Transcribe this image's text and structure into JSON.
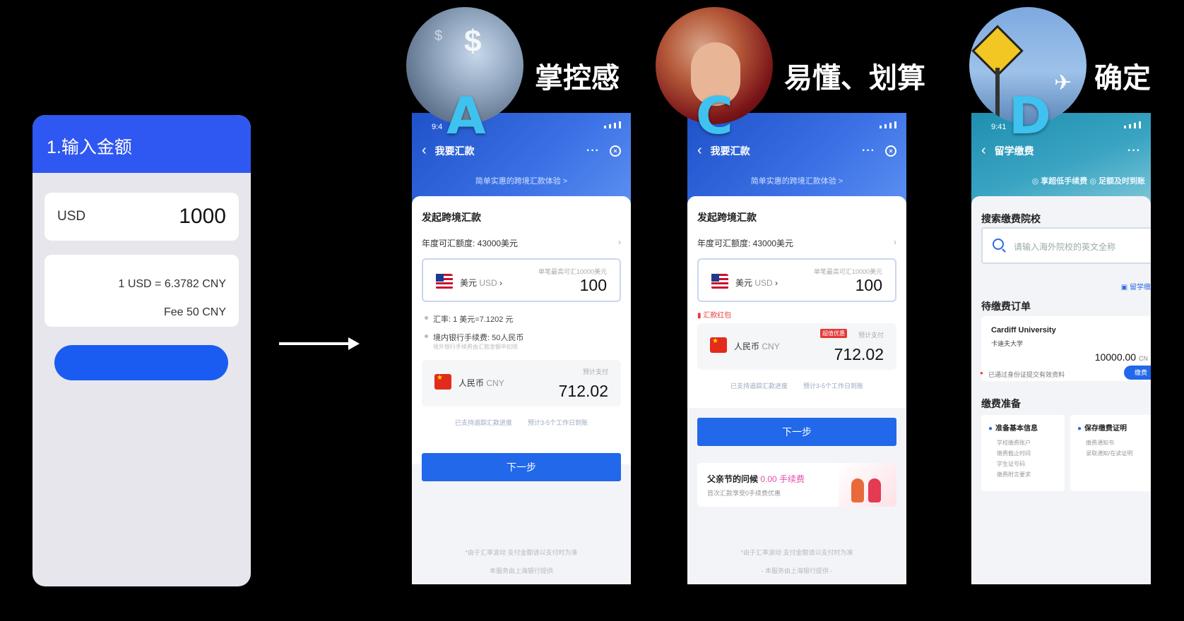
{
  "wireframe": {
    "header": "1.输入金额",
    "currency": "USD",
    "amount": "1000",
    "rate": "1 USD = 6.3782 CNY",
    "fee": "Fee  50 CNY"
  },
  "variants": {
    "a": {
      "letter": "A",
      "label": "掌控感",
      "status_time": "9:4",
      "nav_title": "我要汇款",
      "more": "···",
      "close": "×",
      "tagline": "简单实惠的跨境汇款体验 >",
      "section_title": "发起跨境汇款",
      "quota": "年度可汇额度:  43000美元",
      "send_currency": "美元",
      "send_code": "USD",
      "send_hint": "单笔最高可汇10000美元",
      "send_value": "100",
      "rate_detail": "汇率: 1 美元=7.1202 元",
      "fee_detail": "境内银行手续费:  50人民币",
      "fee_sub": "境外银行手续费由汇款金额中扣除",
      "recv_currency": "人民币",
      "recv_code": "CNY",
      "recv_hint": "预计支付",
      "recv_value": "712.02",
      "check1": "已支持追踪汇款进度",
      "check2": "预计3-5个工作日到账",
      "next_button": "下一步",
      "footer1": "*由于汇率波动 支付金额请以支付时为准",
      "footer2": "本服务由上海银行提供"
    },
    "c": {
      "letter": "C",
      "label": "易懂、划算",
      "status_time": "",
      "nav_title": "我要汇款",
      "more": "···",
      "close": "×",
      "tagline": "简单实惠的跨境汇款体验 >",
      "section_title": "发起跨境汇款",
      "quota": "年度可汇额度:  43000美元",
      "send_currency": "美元",
      "send_code": "USD",
      "send_hint": "单笔最高可汇10000美元",
      "send_value": "100",
      "redpack": "汇款红包",
      "recv_currency": "人民币",
      "recv_code": "CNY",
      "recv_badge": "超值优惠",
      "recv_hint": "预计支付",
      "recv_value": "712.02",
      "check1": "已支持追踪汇款进度",
      "check2": "预计3-5个工作日到账",
      "next_button": "下一步",
      "promo_title": "父亲节的问候",
      "promo_highlight": "0.00 手续费",
      "promo_sub": "首次汇款享受0手续费优惠",
      "footer1": "*由于汇率波动 支付金额请以支付时为准",
      "footer2": "- 本服务由上海银行提供 -"
    },
    "d": {
      "letter": "D",
      "label": "确定",
      "status_time": "9:41",
      "nav_title": "留学缴费",
      "more": "···",
      "tagline": "◎ 享超低手续费   ◎ 足额及时到账",
      "search_title": "搜索缴费院校",
      "search_placeholder": "请输入海外院校的英文全称",
      "link": "留学缴",
      "orders_title": "待缴费订单",
      "school_name": "Cardiff University",
      "school_cn": "卡迪夫大学",
      "amount": "10000.00",
      "amount_unit": "CN",
      "hint": "已通过身份证提交有效资料",
      "pay_button": "缴费",
      "prep_title": "缴费准备",
      "prep1_title": "准备基本信息",
      "prep1_items": [
        "学校缴费账户",
        "缴费截止时间",
        "学生证号码",
        "缴费附言要求"
      ],
      "prep2_title": "保存缴费证明",
      "prep2_items": [
        "缴费通知书",
        "录取通知/在读证明"
      ]
    }
  }
}
